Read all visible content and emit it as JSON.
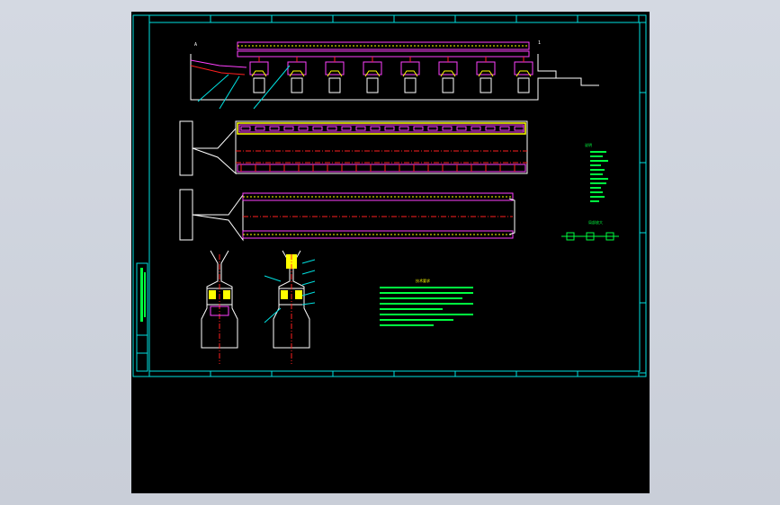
{
  "colors": {
    "background": "#000000",
    "frame": "#00e0e0",
    "magenta": "#ff40ff",
    "yellow": "#ffff00",
    "red": "#ff2020",
    "green": "#00ff40",
    "white": "#ffffff"
  },
  "drawing": {
    "elevation_label": "A",
    "section_label": "1",
    "notes_title": "技术要求",
    "legend_title": "说明",
    "detail_title": "局部放大"
  }
}
